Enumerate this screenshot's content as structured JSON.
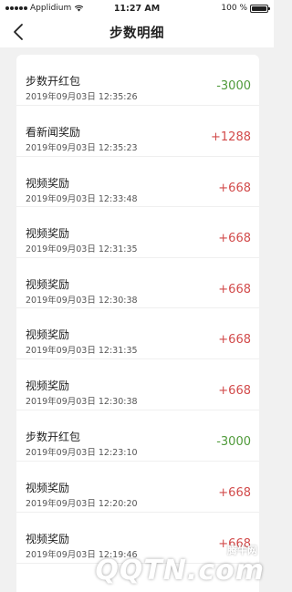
{
  "status_bar": {
    "carrier": "Applidium",
    "time": "11:27 AM",
    "battery_percent": "100 %",
    "battery_level": 1.0
  },
  "nav": {
    "title": "步数明细"
  },
  "records": [
    {
      "title": "步数开红包",
      "time": "2019年09月03日 12:35:26",
      "amount": "-3000",
      "sign": "negative"
    },
    {
      "title": "看新闻奖励",
      "time": "2019年09月03日 12:35:23",
      "amount": "+1288",
      "sign": "positive"
    },
    {
      "title": "视频奖励",
      "time": "2019年09月03日 12:33:48",
      "amount": "+668",
      "sign": "positive"
    },
    {
      "title": "视频奖励",
      "time": "2019年09月03日 12:31:35",
      "amount": "+668",
      "sign": "positive"
    },
    {
      "title": "视频奖励",
      "time": "2019年09月03日 12:30:38",
      "amount": "+668",
      "sign": "positive"
    },
    {
      "title": "视频奖励",
      "time": "2019年09月03日 12:31:35",
      "amount": "+668",
      "sign": "positive"
    },
    {
      "title": "视频奖励",
      "time": "2019年09月03日 12:30:38",
      "amount": "+668",
      "sign": "positive"
    },
    {
      "title": "步数开红包",
      "time": "2019年09月03日 12:23:10",
      "amount": "-3000",
      "sign": "negative"
    },
    {
      "title": "视频奖励",
      "time": "2019年09月03日 12:20:20",
      "amount": "+668",
      "sign": "positive"
    },
    {
      "title": "视频奖励",
      "time": "2019年09月03日 12:19:46",
      "amount": "+668",
      "sign": "positive"
    }
  ],
  "watermark": {
    "site_name": "腾牛网",
    "logo_text": "QQTN.com"
  },
  "colors": {
    "negative": "#4f9a3a",
    "positive": "#d24b4b"
  },
  "icons": {
    "back": "chevron-left-icon",
    "wifi": "wifi-icon",
    "battery": "battery-icon"
  }
}
